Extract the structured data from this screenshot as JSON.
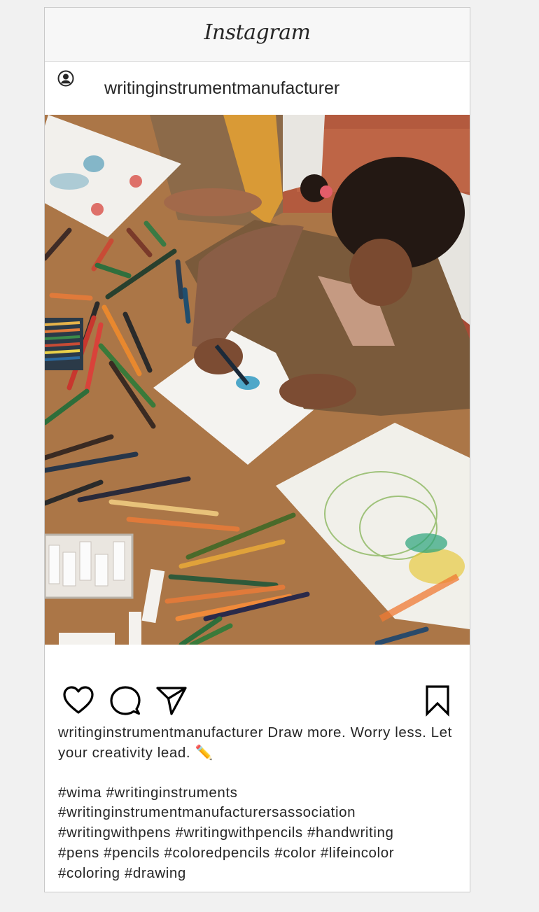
{
  "header": {
    "brand": "Instagram"
  },
  "post": {
    "username": "writinginstrumentmanufacturer",
    "caption_user": "writinginstrumentmanufacturer",
    "caption_text": " Draw more. Worry less. Let your creativity lead. ✏️",
    "hashtags": [
      "#wima #writinginstruments",
      "#writinginstrumentmanufacturersassociation",
      "#writingwithpens #writingwithpencils #handwriting",
      "#pens #pencils #coloredpencils #color #lifeincolor",
      "#coloring #drawing"
    ]
  },
  "icons": {
    "avatar": "user-circle-icon",
    "like": "heart-icon",
    "comment": "comment-icon",
    "share": "send-icon",
    "save": "bookmark-icon"
  },
  "colors": {
    "text": "#262626",
    "header_bg": "#f7f7f7",
    "page_bg": "#f1f1f1",
    "border": "#c9c9c9"
  }
}
